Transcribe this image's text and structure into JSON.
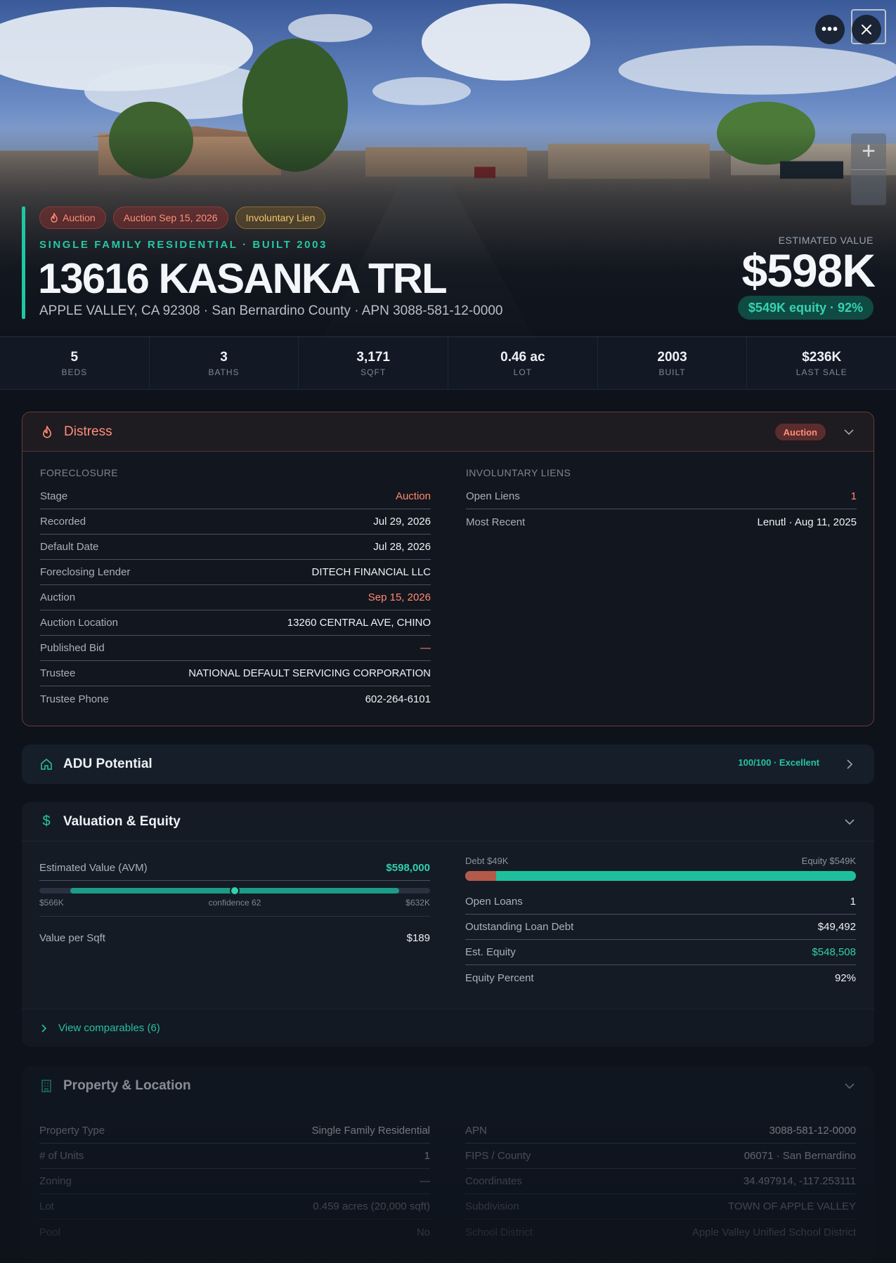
{
  "header": {
    "badges": [
      "Auction",
      "Auction Sep 15, 2026",
      "Involuntary Lien"
    ],
    "subtype": "SINGLE FAMILY RESIDENTIAL · BUILT 2003",
    "address": "13616 KASANKA TRL",
    "location": "APPLE VALLEY, CA 92308 · San Bernardino County · APN 3088-581-12-0000",
    "estimated_label": "ESTIMATED VALUE",
    "estimated_value": "$598K",
    "equity_pill": "$549K equity · 92%",
    "more_icon": "more-horizontal-icon",
    "close_icon": "close-icon",
    "zoom_icon": "plus-icon"
  },
  "stats": [
    {
      "value": "5",
      "label": "BEDS"
    },
    {
      "value": "3",
      "label": "BATHS"
    },
    {
      "value": "3,171",
      "label": "SQFT"
    },
    {
      "value": "0.46 ac",
      "label": "LOT"
    },
    {
      "value": "2003",
      "label": "BUILT"
    },
    {
      "value": "$236K",
      "label": "LAST SALE"
    }
  ],
  "distress": {
    "title": "Distress",
    "pill": "Auction",
    "foreclosure_label": "FORECLOSURE",
    "foreclosure_rows": [
      {
        "k": "Stage",
        "v": "Auction"
      },
      {
        "k": "Recorded",
        "v": "Jul 29, 2026"
      },
      {
        "k": "Default Date",
        "v": "Jul 28, 2026"
      },
      {
        "k": "Foreclosing Lender",
        "v": "DITECH FINANCIAL LLC"
      },
      {
        "k": "Auction",
        "v": "Sep 15, 2026"
      },
      {
        "k": "Auction Location",
        "v": "13260 CENTRAL AVE, CHINO"
      },
      {
        "k": "Published Bid",
        "v": "—"
      },
      {
        "k": "Trustee",
        "v": "NATIONAL DEFAULT SERVICING CORPORATION"
      },
      {
        "k": "Trustee Phone",
        "v": "602-264-6101"
      }
    ],
    "liens_label": "INVOLUNTARY LIENS",
    "liens_rows": [
      {
        "k": "Open Liens",
        "v": "1"
      },
      {
        "k": "Most Recent",
        "v": "Lenutl · Aug 11, 2025"
      }
    ]
  },
  "adu": {
    "title": "ADU Potential",
    "score": "100/100 · Excellent"
  },
  "valuation": {
    "title": "Valuation & Equity",
    "avm_label": "Estimated Value (AVM)",
    "avm_value": "$598,000",
    "avm_low": "$566K",
    "avm_confidence": "confidence 62",
    "avm_high": "$632K",
    "value_per_sqft_label": "Value per Sqft",
    "value_per_sqft": "$189",
    "debt_label": "Debt $49K",
    "equity_label": "Equity $549K",
    "debt_fraction": 0.08,
    "rows": [
      {
        "k": "Open Loans",
        "v": "1"
      },
      {
        "k": "Outstanding Loan Debt",
        "v": "$49,492"
      },
      {
        "k": "Est. Equity",
        "v": "$548,508"
      },
      {
        "k": "Equity Percent",
        "v": "92%"
      }
    ],
    "comparables": "View comparables (6)"
  },
  "property": {
    "title": "Property & Location",
    "left_rows": [
      {
        "k": "Property Type",
        "v": "Single Family Residential"
      },
      {
        "k": "# of Units",
        "v": "1"
      },
      {
        "k": "Zoning",
        "v": "—"
      },
      {
        "k": "Lot",
        "v": "0.459 acres (20,000 sqft)"
      },
      {
        "k": "Pool",
        "v": "No"
      }
    ],
    "right_rows": [
      {
        "k": "APN",
        "v": "3088-581-12-0000"
      },
      {
        "k": "FIPS / County",
        "v": "06071 · San Bernardino"
      },
      {
        "k": "Coordinates",
        "v": "34.497914, -117.253111"
      },
      {
        "k": "Subdivision",
        "v": "TOWN OF APPLE VALLEY"
      },
      {
        "k": "School District",
        "v": "Apple Valley Unified School District"
      }
    ]
  },
  "colors": {
    "accent": "#1fc6a4",
    "danger": "#ff8a70",
    "lien": "#f0c76c",
    "background": "#0d121b"
  }
}
